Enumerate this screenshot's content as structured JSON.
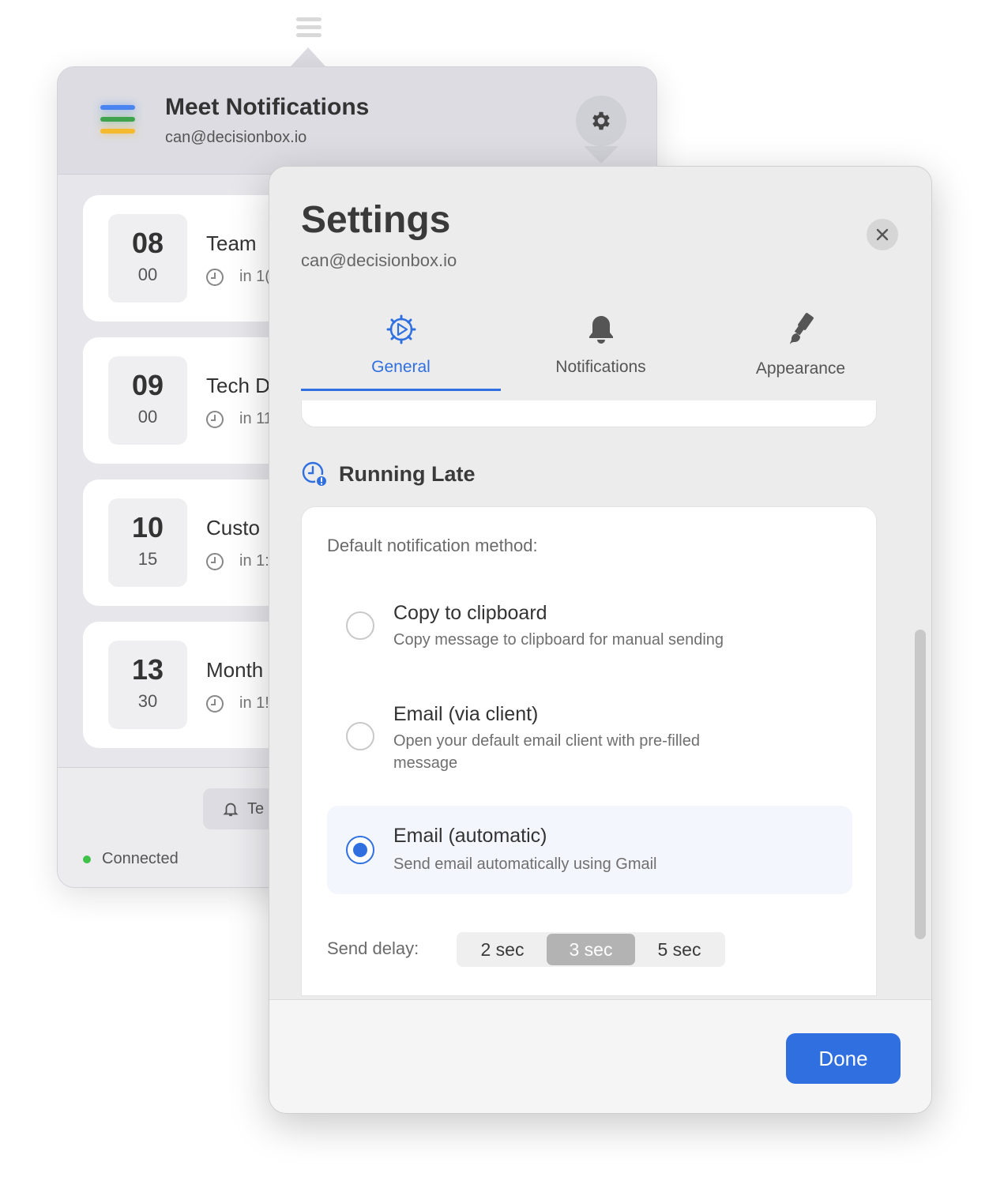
{
  "menubar": {
    "icon": "hamburger-menu-icon"
  },
  "popover": {
    "app_title": "Meet Notifications",
    "account_email": "can@decisionbox.io",
    "events": [
      {
        "hour": "08",
        "minute": "00",
        "title": "Team",
        "relative": "in 1("
      },
      {
        "hour": "09",
        "minute": "00",
        "title": "Tech D",
        "relative": "in 11"
      },
      {
        "hour": "10",
        "minute": "15",
        "title": "Custo",
        "relative": "in 1:"
      },
      {
        "hour": "13",
        "minute": "30",
        "title": "Month",
        "relative": "in 1!"
      }
    ],
    "test_button_label": "Te",
    "status_text": "Connected"
  },
  "settings": {
    "title": "Settings",
    "email": "can@decisionbox.io",
    "tabs": [
      {
        "label": "General",
        "icon": "gear-play-icon",
        "active": true
      },
      {
        "label": "Notifications",
        "icon": "bell-icon",
        "active": false
      },
      {
        "label": "Appearance",
        "icon": "paintbrush-icon",
        "active": false
      }
    ],
    "running_late": {
      "section_title": "Running Late",
      "method_label": "Default notification method:",
      "options": [
        {
          "title": "Copy to clipboard",
          "description": "Copy message to clipboard for manual sending",
          "selected": false
        },
        {
          "title": "Email (via client)",
          "description": "Open your default email client with pre-filled message",
          "selected": false
        },
        {
          "title": "Email (automatic)",
          "description": "Send email automatically using Gmail",
          "selected": true
        }
      ],
      "send_delay_label": "Send delay:",
      "send_delay_options": [
        "2 sec",
        "3 sec",
        "5 sec"
      ],
      "send_delay_selected": "3 sec"
    },
    "done_label": "Done"
  },
  "colors": {
    "accent": "#2f6fe0",
    "status_green": "#3fc24a"
  }
}
